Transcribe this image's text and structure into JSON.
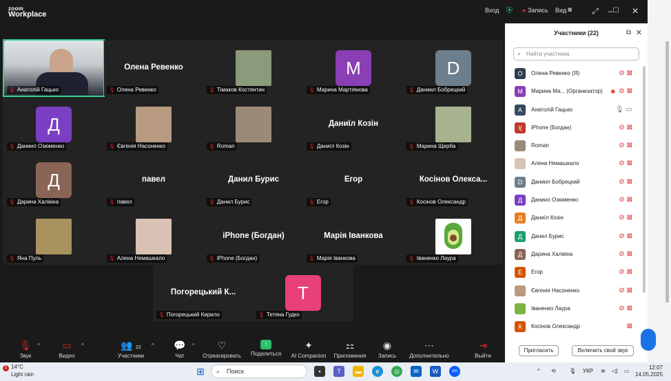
{
  "window": {
    "logo_line1": "zoom",
    "logo_line2": "Workplace",
    "signin": "Вход",
    "record_label": "Запись",
    "view_label": "Вид"
  },
  "gallery": [
    {
      "caption": "Анатолій Гацько",
      "kind": "photo",
      "photo_color": "#c9b79c",
      "active": true
    },
    {
      "caption": "Олена Ревенко",
      "kind": "name",
      "big": "Олена Ревенко"
    },
    {
      "caption": "Тімаков Костянтин",
      "kind": "photo",
      "photo_color": "#8a9a7a"
    },
    {
      "caption": "Марина Мартіянова",
      "kind": "avatar",
      "letter": "М",
      "color": "#8a3fb5"
    },
    {
      "caption": "Даниил Бобрецкий",
      "kind": "avatar",
      "letter": "D",
      "color": "#6d7f8c"
    },
    {
      "caption": "Даниил Озюменко",
      "kind": "avatar",
      "letter": "Д",
      "color": "#7b3fc4"
    },
    {
      "caption": "Євгенія Насоненко",
      "kind": "photo",
      "photo_color": "#b89a80"
    },
    {
      "caption": "Roman",
      "kind": "photo",
      "photo_color": "#9c8a78"
    },
    {
      "caption": "Даниїл Козін",
      "kind": "name",
      "big": "Даниїл Козін"
    },
    {
      "caption": "Марина Щерба",
      "kind": "photo",
      "photo_color": "#a7b38f"
    },
    {
      "caption": "Дарина Халікіна",
      "kind": "avatar",
      "letter": "Д",
      "color": "#8a6457"
    },
    {
      "caption": "павел",
      "kind": "name",
      "big": "павел"
    },
    {
      "caption": "Данил Бурис",
      "kind": "name",
      "big": "Данил Бурис"
    },
    {
      "caption": "Егор",
      "kind": "name",
      "big": "Егор"
    },
    {
      "caption": "Косінов Олександр",
      "kind": "name",
      "big": "Косінов Олекса..."
    },
    {
      "caption": "Яна Пуль",
      "kind": "photo",
      "photo_color": "#a8925e"
    },
    {
      "caption": "Алена Немашкало",
      "kind": "photo",
      "photo_color": "#d9c2b4"
    },
    {
      "caption": "iPhone (Богдан)",
      "kind": "name",
      "big": "iPhone (Богдан)"
    },
    {
      "caption": "Марія Іванкова",
      "kind": "name",
      "big": "Марія Іванкова"
    },
    {
      "caption": "Іваненко Лаура",
      "kind": "photo",
      "photo_color": "#ffffff",
      "avocado": true
    }
  ],
  "gallery_bottom": [
    {
      "caption": "Погорецький Кирило",
      "kind": "name",
      "big": "Погорецький К..."
    },
    {
      "caption": "Тетяна Гудко",
      "kind": "avatar",
      "letter": "Т",
      "color": "#e8407a"
    }
  ],
  "toolbar": {
    "audio": "Звук",
    "video": "Видео",
    "participants": "Участники",
    "participants_count": "22",
    "chat": "Чат",
    "react": "Отреагировать",
    "share": "Поделиться",
    "ai": "AI Companion",
    "apps": "Приложения",
    "record": "Запись",
    "more": "Дополнительно",
    "exit": "Выйти"
  },
  "panel": {
    "title": "Участники (22)",
    "search_placeholder": "Найти участника",
    "participants": [
      {
        "letter": "О",
        "color": "#2c3e50",
        "name": "Олена Ревенко (Я)",
        "muted": true
      },
      {
        "letter": "М",
        "color": "#8a3fb5",
        "name": "Марина Ма... (Организатор)",
        "muted": true,
        "rec": true
      },
      {
        "letter": "А",
        "color": "#34495e",
        "name": "Анатолій Гацько",
        "muted": false
      },
      {
        "letter": "I(",
        "color": "#c0392b",
        "name": "iPhone (Богдан)",
        "muted": true
      },
      {
        "letter": "",
        "color": "#9c8a78",
        "name": "Roman",
        "muted": true
      },
      {
        "letter": "",
        "color": "#d9c2b4",
        "name": "Алена Немашкало",
        "muted": true
      },
      {
        "letter": "D",
        "color": "#6d7f8c",
        "name": "Даниил Бобрецкий",
        "muted": true
      },
      {
        "letter": "Д",
        "color": "#7b3fc4",
        "name": "Даниил Озюменко",
        "muted": true
      },
      {
        "letter": "Д",
        "color": "#e67e22",
        "name": "Даниїл Козін",
        "muted": true
      },
      {
        "letter": "Д",
        "color": "#1e9e6a",
        "name": "Данил Бурис",
        "muted": true
      },
      {
        "letter": "Д",
        "color": "#8a6457",
        "name": "Дарина Халікіна",
        "muted": true
      },
      {
        "letter": "Е",
        "color": "#d35400",
        "name": "Егор",
        "muted": true
      },
      {
        "letter": "",
        "color": "#b89a80",
        "name": "Євгенія Насоненко",
        "muted": true
      },
      {
        "letter": "",
        "color": "#7cb342",
        "name": "Іваненко Лаура",
        "muted": true
      },
      {
        "letter": "К",
        "color": "#d35400",
        "name": "Косінов Олександр",
        "muted": true,
        "cam_only": true
      }
    ],
    "invite": "Пригласить",
    "unmute": "Включить свой звук"
  },
  "taskbar": {
    "temp": "14°C",
    "weather": "Light rain",
    "badge": "1",
    "search": "Поиск",
    "lang": "УКР",
    "time": "12:07",
    "date": "14.05.2025"
  }
}
